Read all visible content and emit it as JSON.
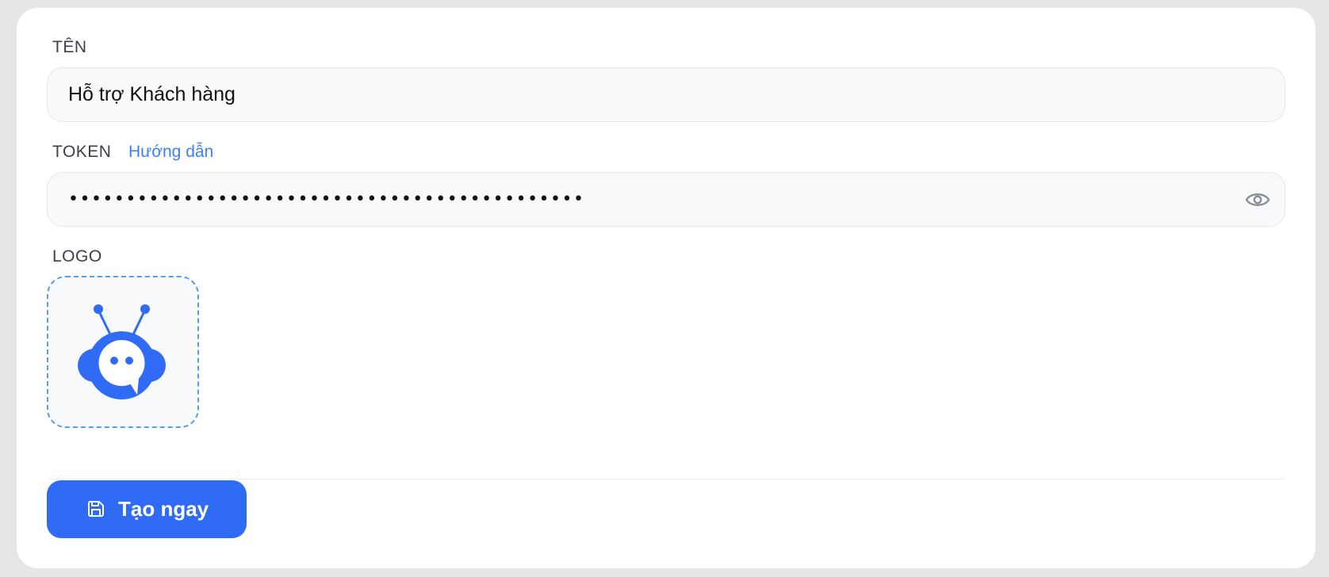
{
  "form": {
    "name": {
      "label": "TÊN",
      "value": "Hỗ trợ Khách hàng"
    },
    "token": {
      "label": "TOKEN",
      "guide_link": "Hướng dẫn",
      "masked_value": "•••••••••••••••••••••••••••••••••••••••••••••"
    },
    "logo": {
      "label": "LOGO",
      "icon": "chatbot-robot-icon"
    },
    "submit": {
      "label": "Tạo ngay",
      "icon": "save-icon"
    }
  },
  "colors": {
    "accent": "#2f6bf5",
    "link": "#3b82f6",
    "dashed_border": "#5b9bf0",
    "field_bg": "#f8f9fb"
  }
}
